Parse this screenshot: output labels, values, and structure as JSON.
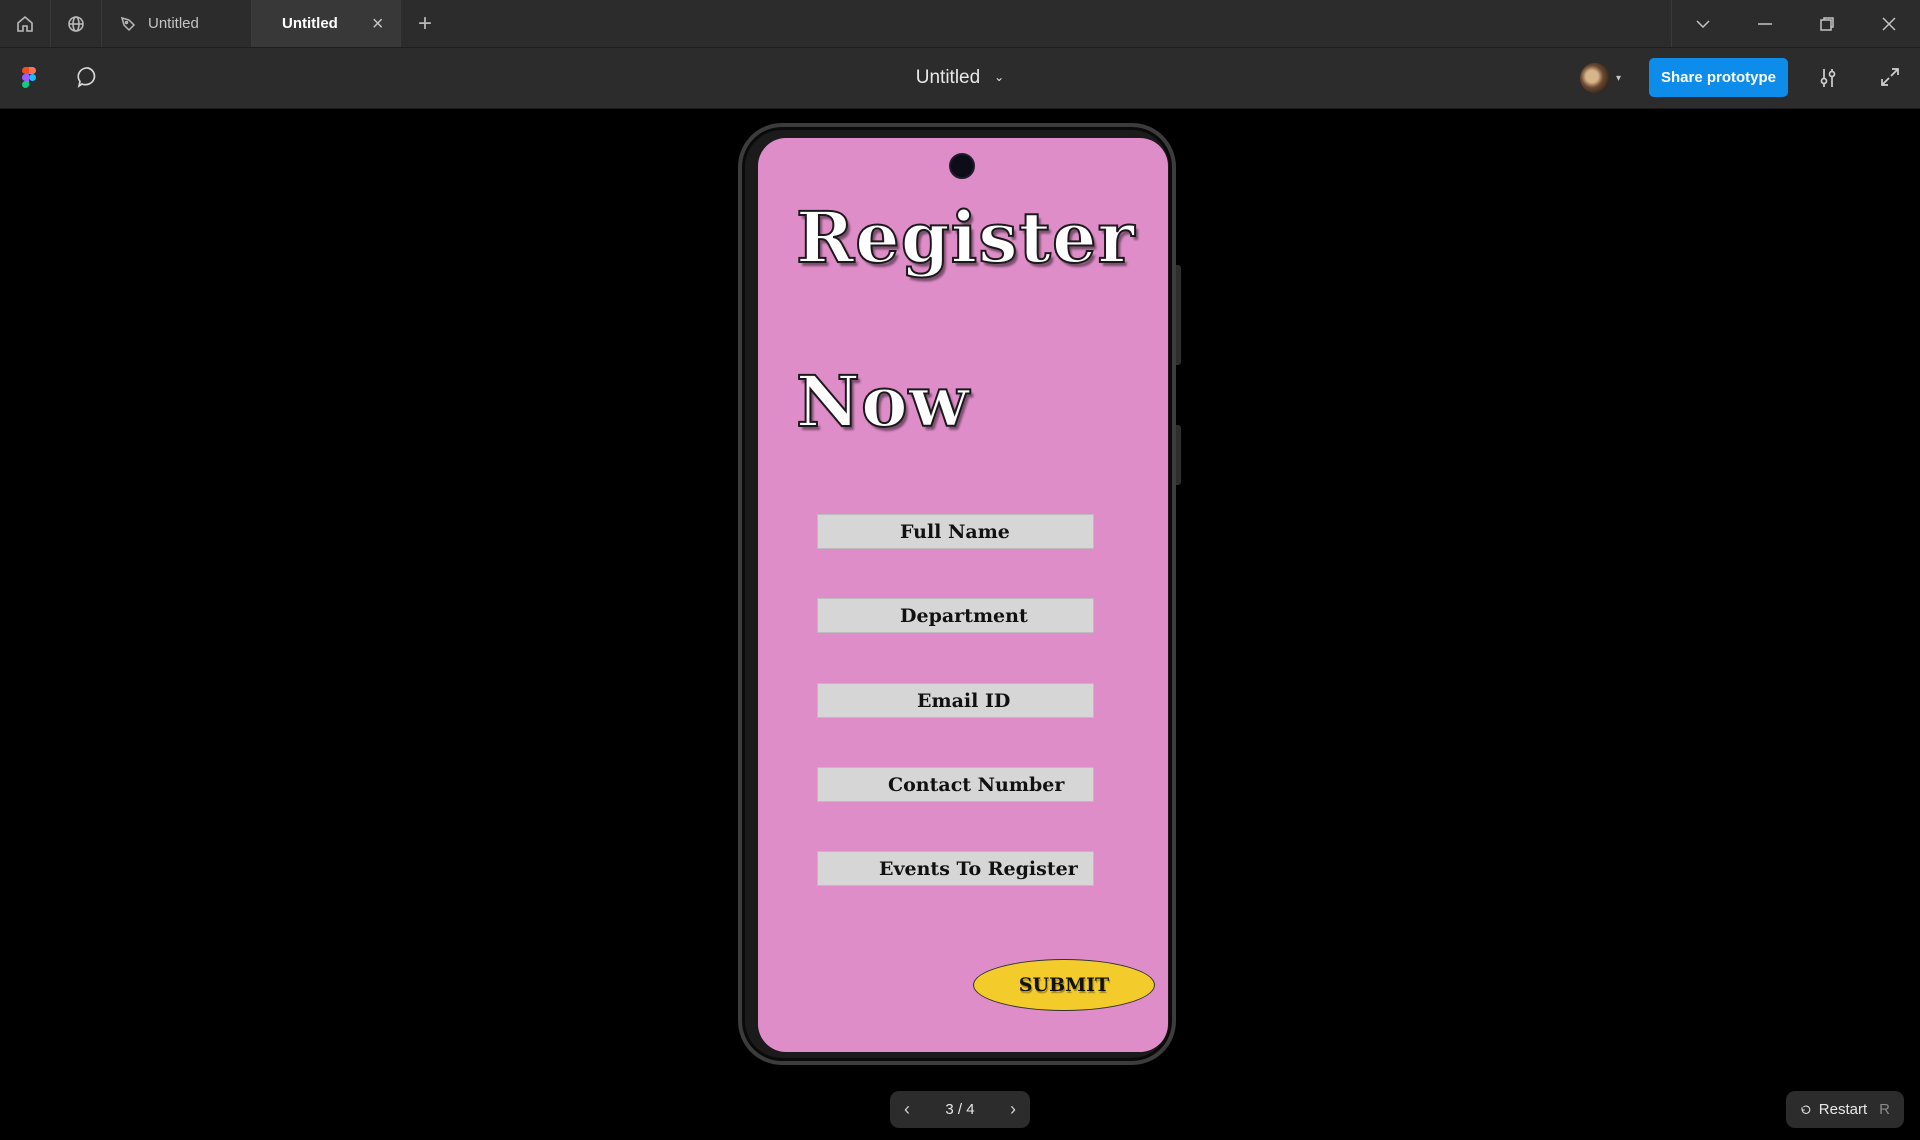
{
  "tabs": [
    {
      "label": "Untitled",
      "icon": "pen-icon"
    },
    {
      "label": "Untitled",
      "icon": "play-icon",
      "active": true
    }
  ],
  "toolbar": {
    "file_title": "Untitled",
    "share_label": "Share prototype"
  },
  "prototype": {
    "heading_line1": "Register",
    "heading_line2": "Now",
    "fields": [
      {
        "label": "Full Name"
      },
      {
        "label": "Department"
      },
      {
        "label": "Email ID"
      },
      {
        "label": "Contact Number"
      },
      {
        "label": "Events To Register"
      }
    ],
    "submit_label": "SUBMIT",
    "colors": {
      "screen_bg": "#df8dc8",
      "field_bg": "#d6d6d6",
      "submit_bg": "#f3cc2b"
    }
  },
  "pager": {
    "label": "3 / 4"
  },
  "restart": {
    "label": "Restart",
    "shortcut": "R"
  },
  "colors": {
    "accent": "#0d8ce9",
    "chrome": "#2c2c2c",
    "canvas": "#000000"
  }
}
